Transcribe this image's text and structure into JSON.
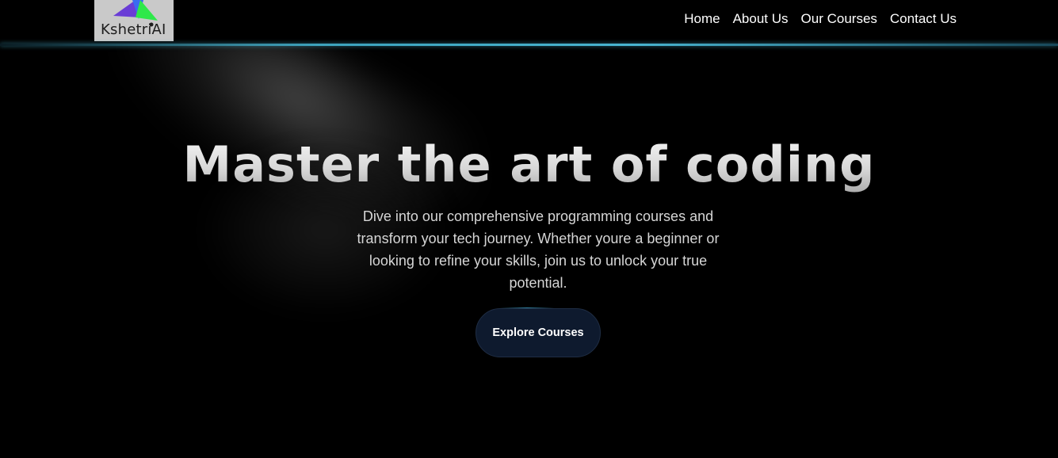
{
  "brand": {
    "logo_text": "KshetriAI",
    "logo_icon": "colored-triangles-logo"
  },
  "nav": {
    "items": [
      {
        "label": "Home"
      },
      {
        "label": "About Us"
      },
      {
        "label": "Our Courses"
      },
      {
        "label": "Contact Us"
      }
    ]
  },
  "hero": {
    "title": "Master the art of coding",
    "description": "Dive into our comprehensive programming courses and transform your tech journey. Whether youre a beginner or looking to refine your skills, join us to unlock your true potential.",
    "cta_label": "Explore Courses"
  },
  "colors": {
    "background": "#000000",
    "nav_glow": "#46bedc",
    "cta_background": "#0e1a2e",
    "text_primary": "#ffffff",
    "text_secondary": "#d6d6d6"
  }
}
